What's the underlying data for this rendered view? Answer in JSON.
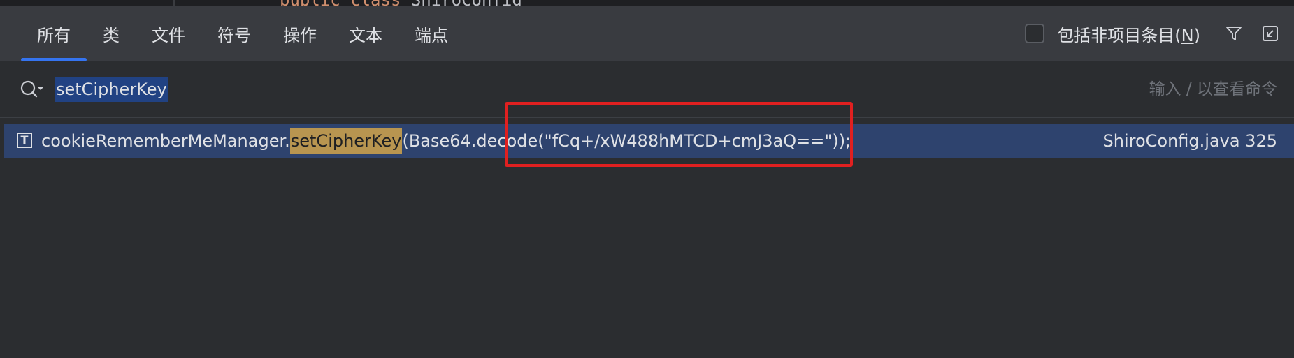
{
  "editor_peek": {
    "code_keyword": "public class ",
    "code_class": "ShiroConfig"
  },
  "tabs": [
    {
      "label": "所有",
      "active": true
    },
    {
      "label": "类"
    },
    {
      "label": "文件"
    },
    {
      "label": "符号"
    },
    {
      "label": "操作"
    },
    {
      "label": "文本"
    },
    {
      "label": "端点"
    }
  ],
  "options": {
    "include_non_project_label": "包括非项目条目(",
    "include_non_project_mnemonic": "N",
    "include_non_project_suffix": ")",
    "include_non_project_checked": false
  },
  "search": {
    "query": "setCipherKey",
    "hint": "输入 / 以查看命令"
  },
  "result": {
    "type_icon": "T",
    "prefix": "cookieRememberMeManager.",
    "match": "setCipherKey",
    "suffix": "(Base64.decode(\"fCq+/xW488hMTCD+cmJ3aQ==\"));",
    "location": "ShiroConfig.java 325"
  },
  "colors": {
    "accent": "#3574f0",
    "selection": "#2e436e",
    "match_highlight": "#b89550",
    "annotation": "#e02020"
  }
}
